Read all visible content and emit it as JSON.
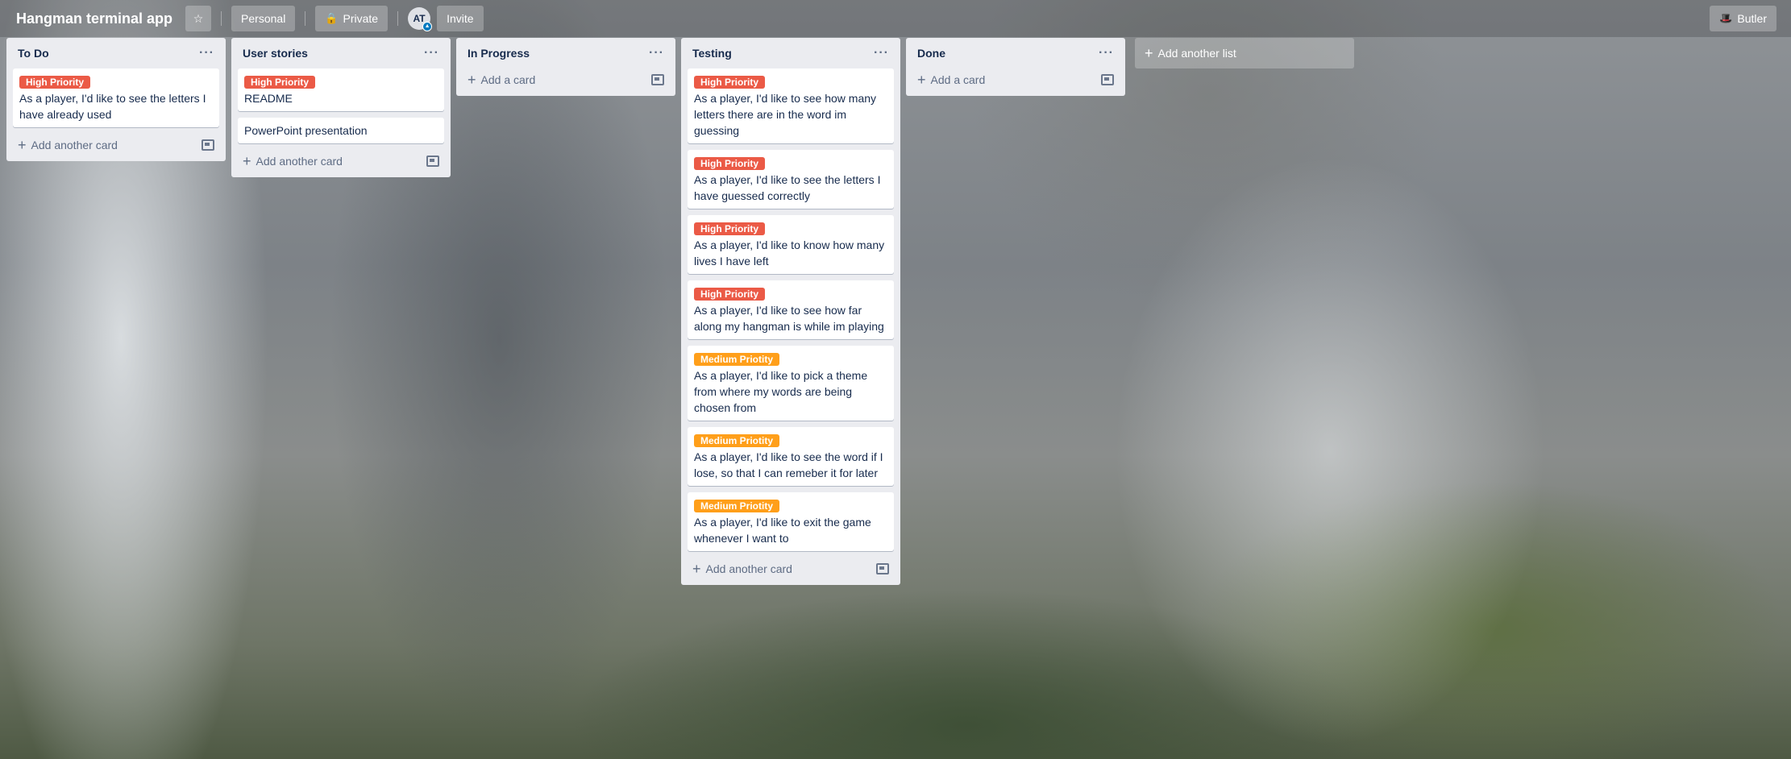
{
  "header": {
    "board_title": "Hangman terminal app",
    "star_icon": "star-icon",
    "personal_label": "Personal",
    "private_label": "Private",
    "avatar_initials": "AT",
    "invite_label": "Invite",
    "butler_label": "Butler"
  },
  "lists": [
    {
      "title": "To Do",
      "cards": [
        {
          "label": "High Priority",
          "label_color": "#eb5a46",
          "text": "As a player, I'd like to see the letters I have already used"
        }
      ],
      "add_label": "Add another card"
    },
    {
      "title": "User stories",
      "cards": [
        {
          "label": "High Priority",
          "label_color": "#eb5a46",
          "text": "README"
        },
        {
          "label": "",
          "text": "PowerPoint presentation"
        }
      ],
      "add_label": "Add another card"
    },
    {
      "title": "In Progress",
      "cards": [],
      "add_label": "Add a card"
    },
    {
      "title": "Testing",
      "cards": [
        {
          "label": "High Priority",
          "label_color": "#eb5a46",
          "text": "As a player, I'd like to see how many letters there are in the word im guessing"
        },
        {
          "label": "High Priority",
          "label_color": "#eb5a46",
          "text": "As a player, I'd like to see the letters I have guessed correctly"
        },
        {
          "label": "High Priority",
          "label_color": "#eb5a46",
          "text": "As a player, I'd like to know how many lives I have left"
        },
        {
          "label": "High Priority",
          "label_color": "#eb5a46",
          "text": "As a player, I'd like to see how far along my hangman is while im playing"
        },
        {
          "label": "Medium Priotity",
          "label_color": "#ff9f1a",
          "text": "As a player, I'd like to pick a theme from where my words are being chosen from"
        },
        {
          "label": "Medium Priotity",
          "label_color": "#ff9f1a",
          "text": "As a player, I'd like to see the word if I lose, so that I can remeber it for later"
        },
        {
          "label": "Medium Priotity",
          "label_color": "#ff9f1a",
          "text": "As a player, I'd like to exit the game whenever I want to"
        }
      ],
      "add_label": "Add another card"
    },
    {
      "title": "Done",
      "cards": [],
      "add_label": "Add a card"
    }
  ],
  "add_list_label": "Add another list"
}
